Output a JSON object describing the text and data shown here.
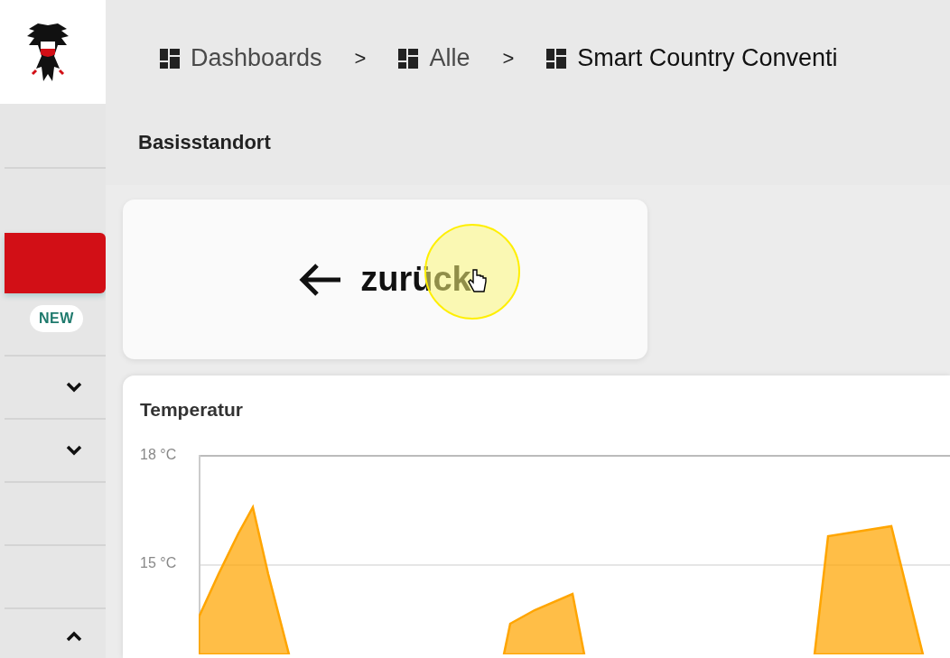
{
  "sidebar": {
    "items": [
      {
        "kind": "plain"
      },
      {
        "kind": "active",
        "selected": true,
        "badge": "NEW"
      },
      {
        "kind": "expand",
        "expanded": false
      },
      {
        "kind": "expand",
        "expanded": false
      },
      {
        "kind": "plain"
      },
      {
        "kind": "plain"
      },
      {
        "kind": "expand",
        "expanded": true
      }
    ]
  },
  "breadcrumbs": [
    {
      "label": "Dashboards",
      "current": false
    },
    {
      "label": "Alle",
      "current": false
    },
    {
      "label": "Smart Country Conventi",
      "current": true
    }
  ],
  "separator": ">",
  "page_title": "Basisstandort",
  "back_button": {
    "label": "zurück"
  },
  "chart": {
    "title": "Temperatur",
    "y_axis_labels": [
      "18 °C",
      "15 °C"
    ]
  }
}
